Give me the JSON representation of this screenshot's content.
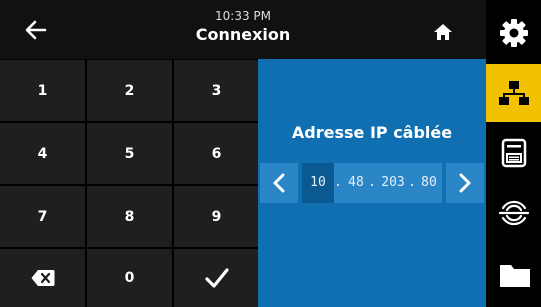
{
  "header": {
    "time": "10:33 PM",
    "title": "Connexion"
  },
  "keypad": {
    "keys": [
      "1",
      "2",
      "3",
      "4",
      "5",
      "6",
      "7",
      "8",
      "9",
      "0"
    ]
  },
  "panel": {
    "title": "Adresse IP câblée",
    "ip": {
      "octets": [
        "10",
        "48",
        "203",
        "80"
      ],
      "separator": ".",
      "selected_octet_index": 0
    }
  },
  "sidebar": {
    "items": [
      "settings-icon",
      "network-icon",
      "printer-icon",
      "sensor-icon",
      "folder-icon"
    ],
    "active_index": 1,
    "active_color": "#f2c200"
  },
  "colors": {
    "panel_bg": "#0f6fb0",
    "header_bg": "#111111",
    "key_bg": "#1f1f1f"
  }
}
